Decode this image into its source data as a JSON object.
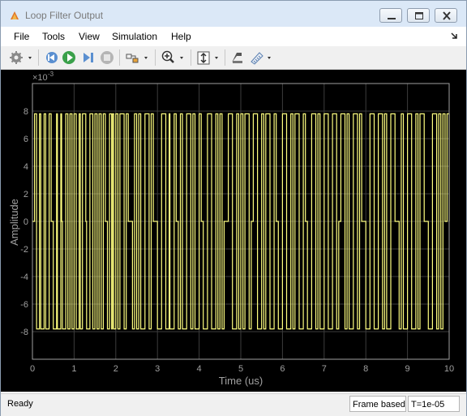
{
  "window": {
    "title": "Loop Filter Output"
  },
  "menu": {
    "items": [
      "File",
      "Tools",
      "View",
      "Simulation",
      "Help"
    ]
  },
  "toolbar": {
    "buttons": [
      "configuration-icon",
      "step-back-icon",
      "run-icon",
      "step-forward-icon",
      "stop-icon",
      "highlight-block-icon",
      "zoom-in-icon",
      "scale-axes-icon",
      "style-icon",
      "measurements-icon"
    ]
  },
  "status": {
    "state": "Ready",
    "mode": "Frame based",
    "sample_time": "T=1e-05"
  },
  "chart_data": {
    "type": "line",
    "xlabel": "Time (us)",
    "ylabel": "Amplitude",
    "exponent_label": "×10",
    "exponent_value": "-3",
    "xlim": [
      0,
      10
    ],
    "ylim": [
      -10,
      10
    ],
    "xticks": [
      "0",
      "1",
      "2",
      "3",
      "4",
      "5",
      "6",
      "7",
      "8",
      "9",
      "10"
    ],
    "yticks": [
      "-8",
      "-6",
      "-4",
      "-2",
      "0",
      "2",
      "4",
      "6",
      "8"
    ],
    "ytick_values": [
      -8,
      -6,
      -4,
      -2,
      0,
      2,
      4,
      6,
      8
    ],
    "grid": true,
    "line_color": "#ffff80",
    "background": "#000000",
    "series": [
      {
        "x": [
          0,
          0.05,
          0.1,
          0.17,
          0.2,
          0.28,
          0.32,
          0.4,
          0.45,
          0.5,
          0.58,
          0.6,
          0.68,
          0.7,
          0.72,
          0.8,
          0.85,
          0.9,
          0.95,
          1.0,
          1.05,
          1.12,
          1.15,
          1.2,
          1.28,
          1.3,
          1.38,
          1.45,
          1.5,
          1.55,
          1.6,
          1.65,
          1.7,
          1.75,
          1.8,
          1.85,
          1.9,
          1.92,
          1.95,
          2.0,
          2.05,
          2.1,
          2.2,
          2.25,
          2.3,
          2.4,
          2.45,
          2.5,
          2.55,
          2.6,
          2.7,
          2.8,
          2.85,
          2.9,
          3.0,
          3.1,
          3.2,
          3.28,
          3.3,
          3.4,
          3.45,
          3.5,
          3.55,
          3.6,
          3.7,
          3.8,
          3.85,
          3.9,
          4.0,
          4.05,
          4.1,
          4.2,
          4.3,
          4.4,
          4.45,
          4.5,
          4.55,
          4.6,
          4.7,
          4.8,
          4.9,
          4.95,
          5.0,
          5.05,
          5.1,
          5.2,
          5.25,
          5.3,
          5.4,
          5.5,
          5.55,
          5.6,
          5.7,
          5.8,
          5.85,
          5.9,
          6.0,
          6.1,
          6.2,
          6.25,
          6.3,
          6.4,
          6.5,
          6.55,
          6.6,
          6.7,
          6.8,
          6.85,
          6.9,
          7.0,
          7.1,
          7.2,
          7.3,
          7.35,
          7.4,
          7.5,
          7.55,
          7.6,
          7.7,
          7.8,
          7.85,
          7.9,
          8.0,
          8.1,
          8.2,
          8.3,
          8.4,
          8.45,
          8.5,
          8.6,
          8.7,
          8.8,
          8.85,
          8.9,
          9.0,
          9.1,
          9.2,
          9.25,
          9.3,
          9.4,
          9.5,
          9.6,
          9.7,
          9.75,
          9.8,
          9.85,
          9.9,
          9.95,
          10.0
        ],
        "y": [
          0,
          7.8,
          -7.8,
          7.8,
          -7.8,
          7.8,
          -7.8,
          7.8,
          0,
          -7.8,
          7.8,
          -7.8,
          7.8,
          0,
          -7.8,
          7.8,
          -7.8,
          7.8,
          -7.8,
          7.8,
          -7.8,
          7.8,
          -7.8,
          7.8,
          0,
          -7.8,
          7.8,
          -7.8,
          7.8,
          -7.8,
          7.8,
          -7.8,
          7.8,
          0,
          -7.8,
          7.8,
          -7.8,
          7.8,
          -7.8,
          7.8,
          -7.8,
          7.8,
          -7.8,
          7.8,
          0,
          -7.8,
          7.8,
          -7.8,
          7.8,
          -7.8,
          7.8,
          -7.8,
          7.8,
          0,
          -7.8,
          7.8,
          -7.8,
          7.8,
          -7.8,
          7.8,
          0,
          -7.8,
          7.8,
          -7.8,
          7.8,
          -7.8,
          7.8,
          -7.8,
          7.8,
          0,
          -7.8,
          7.8,
          -7.8,
          7.8,
          -7.8,
          7.8,
          -7.8,
          0,
          7.8,
          -7.8,
          7.8,
          -7.8,
          7.8,
          -7.8,
          7.8,
          -7.8,
          0,
          7.8,
          -7.8,
          7.8,
          -7.8,
          7.8,
          -7.8,
          7.8,
          0,
          -7.8,
          7.8,
          -7.8,
          7.8,
          -7.8,
          7.8,
          -7.8,
          7.8,
          0,
          -7.8,
          7.8,
          -7.8,
          7.8,
          -7.8,
          7.8,
          -7.8,
          7.8,
          -7.8,
          0,
          7.8,
          -7.8,
          7.8,
          -7.8,
          7.8,
          -7.8,
          7.8,
          0,
          -7.8,
          7.8,
          -7.8,
          7.8,
          -7.8,
          7.8,
          -7.8,
          7.8,
          0,
          -7.8,
          7.8,
          -7.8,
          7.8,
          -7.8,
          7.8,
          -7.8,
          7.8,
          0,
          -7.8,
          7.8,
          -7.8,
          7.8,
          -7.8,
          7.8,
          0,
          7.8,
          0
        ]
      }
    ]
  }
}
